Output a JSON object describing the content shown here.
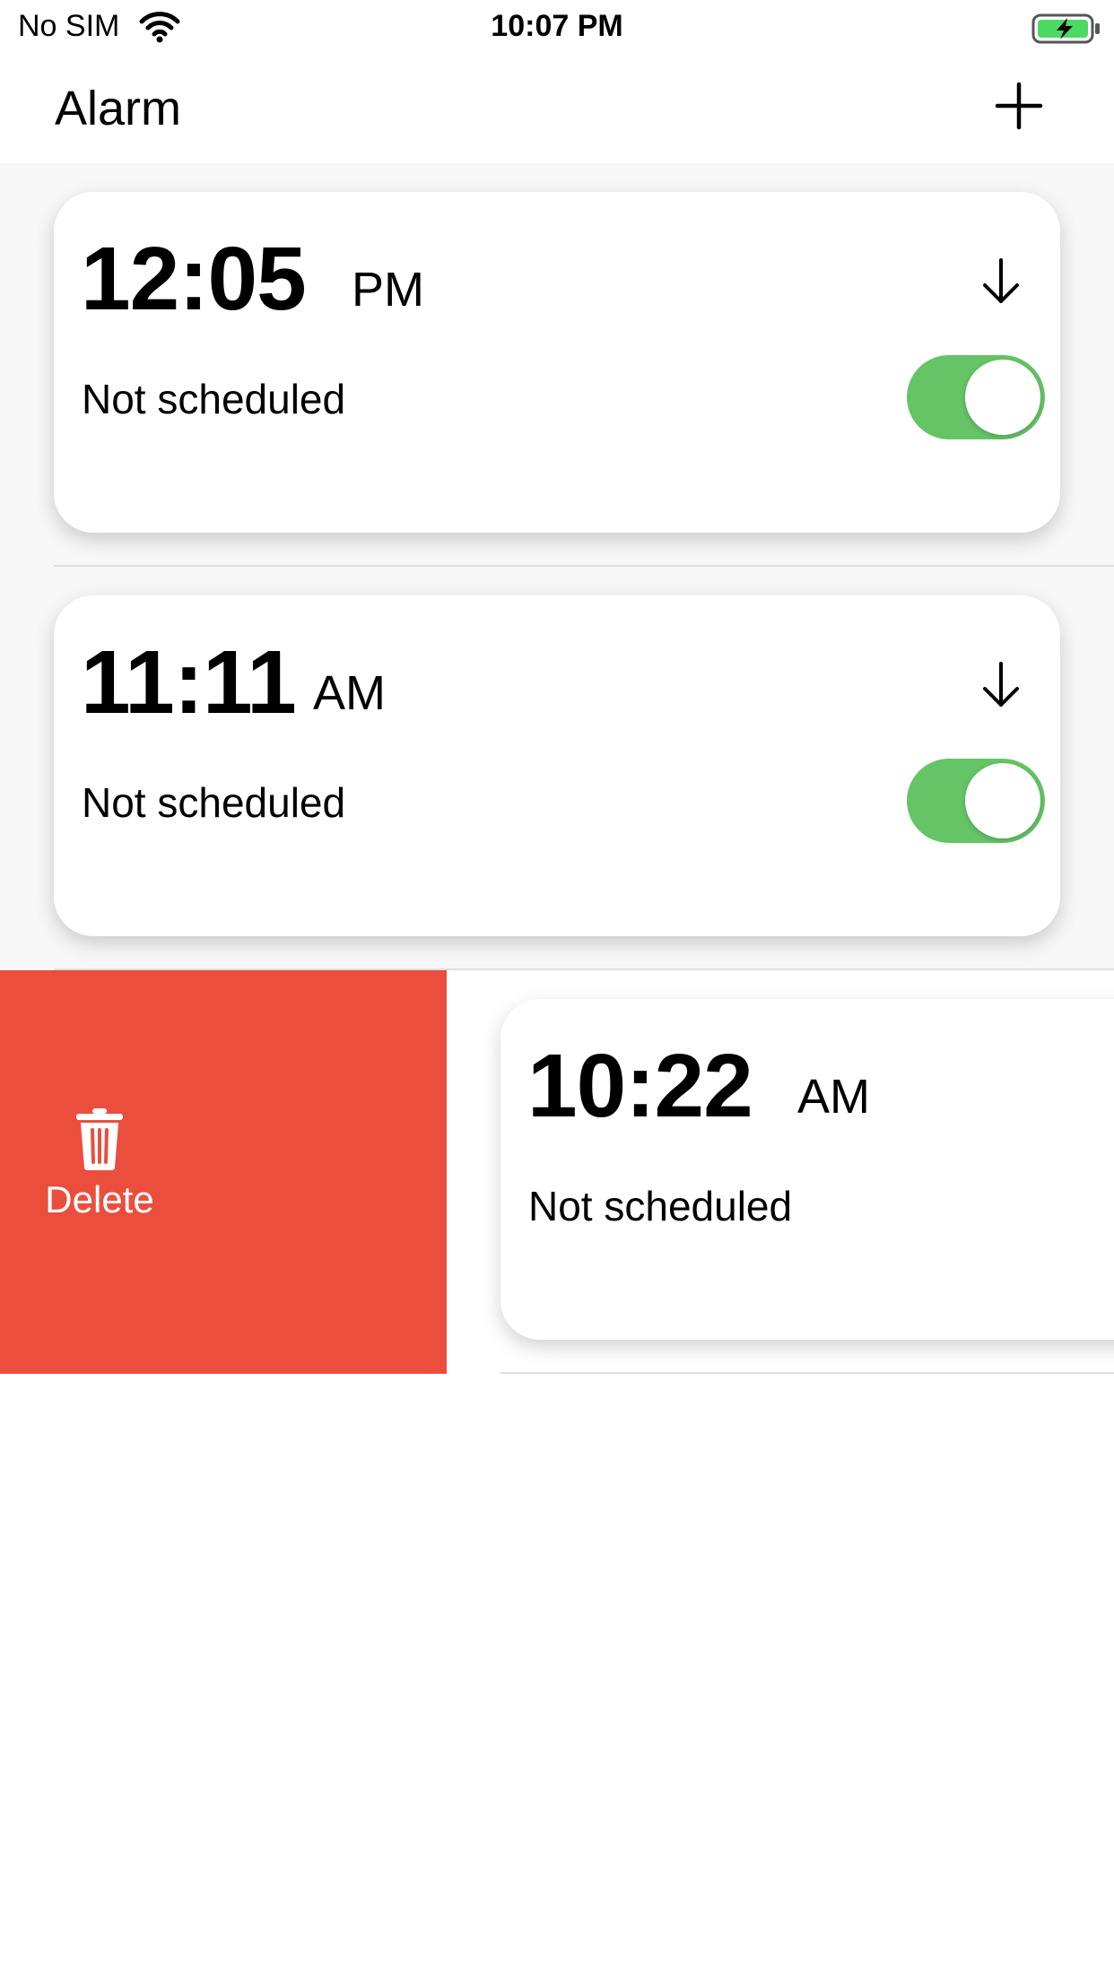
{
  "status_bar": {
    "carrier": "No SIM",
    "time": "10:07 PM",
    "wifi_icon": "wifi-icon",
    "battery_icon": "battery-charging-icon"
  },
  "nav": {
    "title": "Alarm",
    "add_icon": "plus-icon"
  },
  "alarms": [
    {
      "time": "12:05",
      "period": "PM",
      "status": "Not scheduled",
      "enabled": true
    },
    {
      "time": "11:11",
      "period": "AM",
      "status": "Not scheduled",
      "enabled": true
    },
    {
      "time": "10:22",
      "period": "AM",
      "status": "Not scheduled",
      "enabled": true
    }
  ],
  "swipe_action": {
    "label": "Delete",
    "icon": "trash-icon"
  },
  "colors": {
    "toggle_on": "#65c466",
    "delete": "#eb4e3d",
    "list_background": "#f7f7f7"
  }
}
